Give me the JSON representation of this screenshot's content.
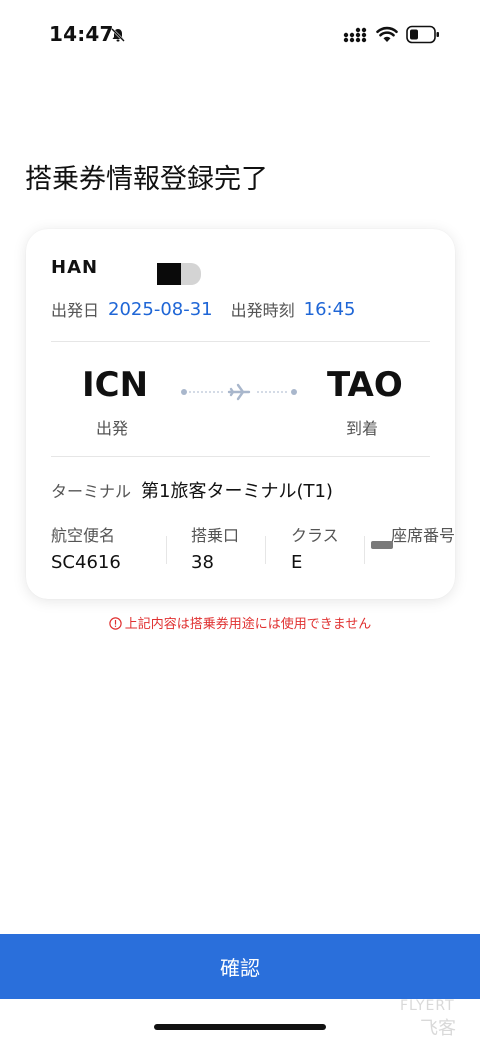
{
  "status_bar": {
    "time": "14:47"
  },
  "header": {
    "title": "搭乗券情報登録完了"
  },
  "ticket": {
    "passenger_name": "HAN",
    "departure_date_label": "出発日",
    "departure_date": "2025-08-31",
    "departure_time_label": "出発時刻",
    "departure_time": "16:45",
    "origin_code": "ICN",
    "origin_label": "出発",
    "destination_code": "TAO",
    "destination_label": "到着",
    "terminal_label": "ターミナル",
    "terminal_value": "第1旅客ターミナル(T1)",
    "fields": [
      {
        "label": "航空便名",
        "value": "SC4616"
      },
      {
        "label": "搭乗口",
        "value": "38"
      },
      {
        "label": "クラス",
        "value": "E"
      },
      {
        "label": "座席番号",
        "value": ""
      }
    ]
  },
  "warning": {
    "text": "上記内容は搭乗券用途には使用できません"
  },
  "footer": {
    "confirm_label": "確認"
  },
  "watermark": {
    "top": "FLYERT",
    "bottom": "飞客"
  },
  "colors": {
    "accent": "#2a6fdb",
    "link_blue": "#1f66d6",
    "warning": "#e03131"
  }
}
